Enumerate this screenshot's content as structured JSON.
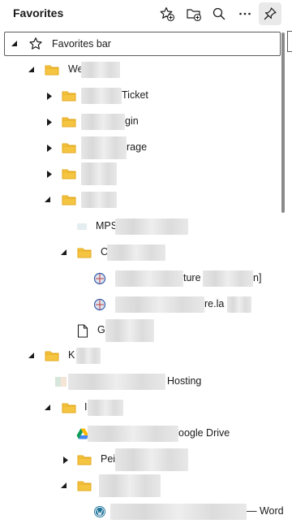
{
  "header": {
    "title": "Favorites",
    "buttons": [
      {
        "name": "add-favorite-button",
        "icon": "star-plus-icon"
      },
      {
        "name": "add-folder-button",
        "icon": "folder-plus-icon"
      },
      {
        "name": "search-button",
        "icon": "search-icon"
      },
      {
        "name": "more-button",
        "icon": "more-icon"
      },
      {
        "name": "pin-button",
        "icon": "pin-icon"
      }
    ]
  },
  "tree": {
    "favorites_bar": "Favorites bar",
    "items": [
      {
        "label": "We",
        "type": "folder",
        "expanded": true
      },
      {
        "label": "Ticket",
        "type": "folder",
        "expanded": false
      },
      {
        "label": "gin",
        "type": "folder",
        "expanded": false
      },
      {
        "label": "rage",
        "type": "folder",
        "expanded": false
      },
      {
        "label": "",
        "type": "folder",
        "expanded": false
      },
      {
        "label": "",
        "type": "folder",
        "expanded": true
      },
      {
        "label": "MPS",
        "type": "link"
      },
      {
        "label": "C",
        "type": "folder",
        "expanded": true
      },
      {
        "label": "ture",
        "label_end": "n]",
        "type": "link"
      },
      {
        "label": "re.la",
        "type": "link"
      },
      {
        "label": "G",
        "type": "page"
      },
      {
        "label": "K",
        "type": "folder",
        "expanded": true
      },
      {
        "label": "Hosting",
        "type": "link"
      },
      {
        "label": "I",
        "type": "folder",
        "expanded": true
      },
      {
        "label": "oogle Drive",
        "type": "link"
      },
      {
        "label": "Pei",
        "type": "folder",
        "expanded": false
      },
      {
        "label": "",
        "type": "folder",
        "expanded": true
      },
      {
        "label": "— Word",
        "type": "link"
      }
    ]
  },
  "colors": {
    "folder": "#f5c542",
    "folder_dark": "#e3a81c",
    "chevron": "#1a1a1a",
    "scroll_thumb": "#8a8a8a"
  }
}
